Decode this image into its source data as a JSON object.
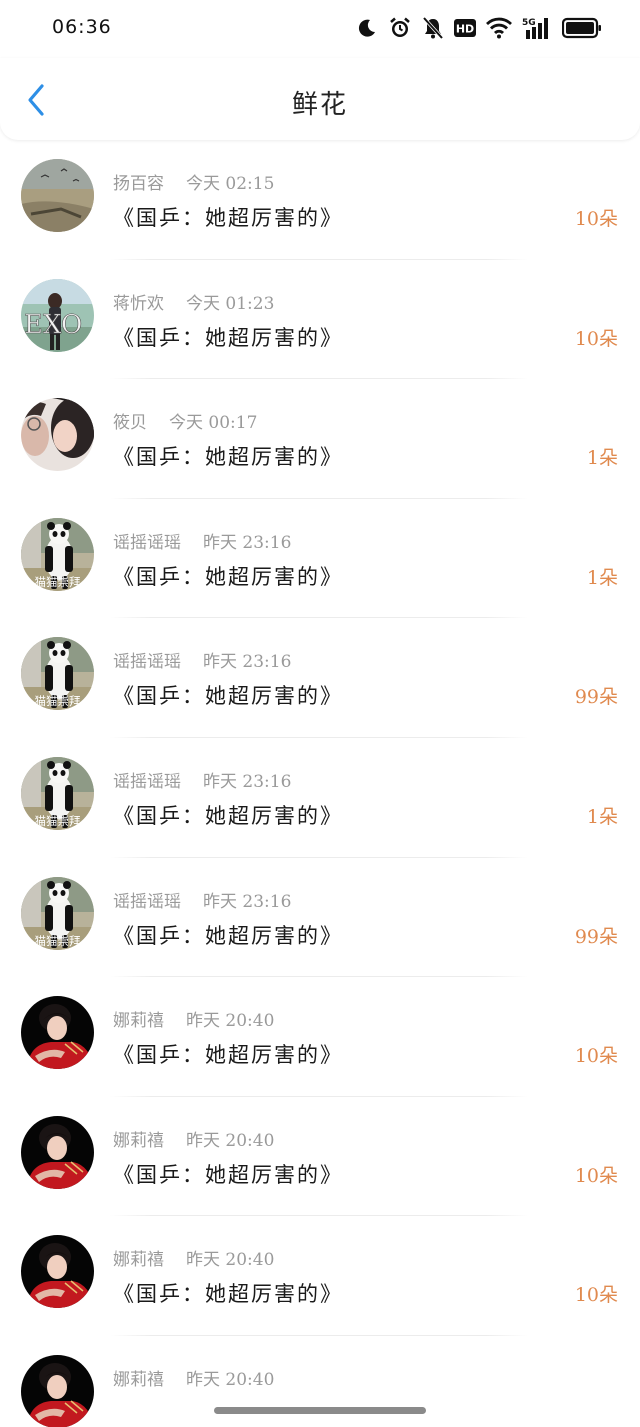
{
  "status_bar": {
    "time": "06:36",
    "icons": [
      "moon-icon",
      "alarm-icon",
      "mute-bell-icon",
      "hd-icon",
      "wifi-icon",
      "signal-5g-icon",
      "battery-icon"
    ],
    "hd_label": "HD",
    "network_label": "5G"
  },
  "header": {
    "title": "鲜花",
    "back_icon": "chevron-left-icon",
    "accent_color": "#2e8fe6"
  },
  "count_color": "#e08a4f",
  "items": [
    {
      "name": "扬百容",
      "time": "今天 02:15",
      "title": "《国乒：她超厉害的》",
      "count": "10朵",
      "avatar": "landscape"
    },
    {
      "name": "蒋忻欢",
      "time": "今天 01:23",
      "title": "《国乒：她超厉害的》",
      "count": "10朵",
      "avatar": "exo"
    },
    {
      "name": "筱贝",
      "time": "今天 00:17",
      "title": "《国乒：她超厉害的》",
      "count": "1朵",
      "avatar": "portrait"
    },
    {
      "name": "谣摇谣瑶",
      "time": "昨天 23:16",
      "title": "《国乒：她超厉害的》",
      "count": "1朵",
      "avatar": "panda",
      "avatar_caption": "猫猫崇拜"
    },
    {
      "name": "谣摇谣瑶",
      "time": "昨天 23:16",
      "title": "《国乒：她超厉害的》",
      "count": "99朵",
      "avatar": "panda",
      "avatar_caption": "猫猫崇拜"
    },
    {
      "name": "谣摇谣瑶",
      "time": "昨天 23:16",
      "title": "《国乒：她超厉害的》",
      "count": "1朵",
      "avatar": "panda",
      "avatar_caption": "猫猫崇拜"
    },
    {
      "name": "谣摇谣瑶",
      "time": "昨天 23:16",
      "title": "《国乒：她超厉害的》",
      "count": "99朵",
      "avatar": "panda",
      "avatar_caption": "猫猫崇拜"
    },
    {
      "name": "娜莉禧",
      "time": "昨天 20:40",
      "title": "《国乒：她超厉害的》",
      "count": "10朵",
      "avatar": "red"
    },
    {
      "name": "娜莉禧",
      "time": "昨天 20:40",
      "title": "《国乒：她超厉害的》",
      "count": "10朵",
      "avatar": "red"
    },
    {
      "name": "娜莉禧",
      "time": "昨天 20:40",
      "title": "《国乒：她超厉害的》",
      "count": "10朵",
      "avatar": "red"
    },
    {
      "name": "娜莉禧",
      "time": "昨天 20:40",
      "title": "",
      "count": "",
      "avatar": "red"
    }
  ]
}
